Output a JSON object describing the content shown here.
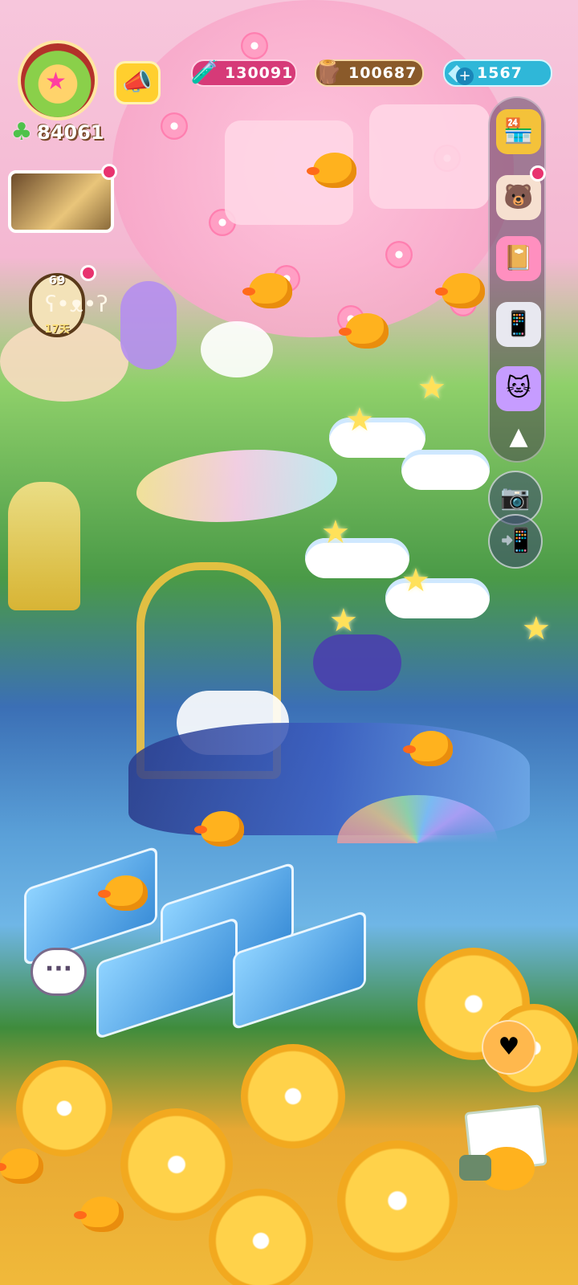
{
  "hud": {
    "clover_count": "84061",
    "resources": {
      "potion": "130091",
      "wood": "100687",
      "gem": "1567"
    },
    "pet_level": "69",
    "pet_days": "17天"
  },
  "icons": {
    "avatar": "player-avatar",
    "clover": "clover-icon",
    "announcement": "megaphone-icon",
    "potion": "potion-icon",
    "wood": "wood-log-icon",
    "gem": "gem-icon",
    "plus": "plus-icon"
  },
  "colors": {
    "potion_bar": "#d63a78",
    "wood_bar": "#8a5a2a",
    "gem_bar": "#2fb7d8",
    "notification": "#e8336f",
    "clover": "#4fc24a"
  }
}
